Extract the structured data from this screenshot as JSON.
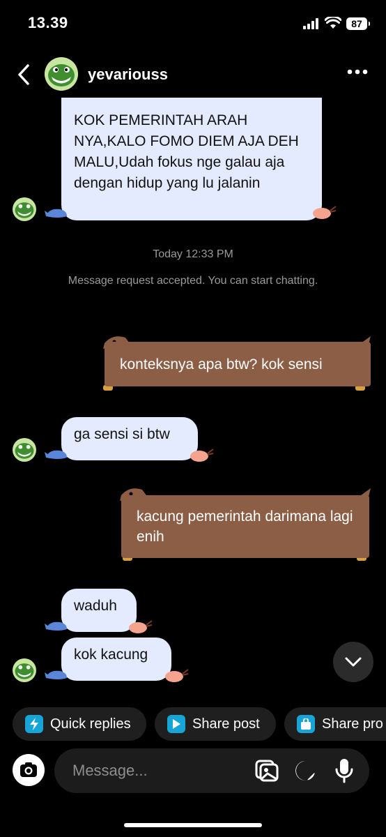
{
  "status_bar": {
    "time": "13.39",
    "battery": "87"
  },
  "header": {
    "username": "yevariouss"
  },
  "messages": {
    "first_incoming": "KOK PEMERINTAH ARAH NYA,KALO FOMO DIEM AJA DEH MALU,Udah fokus nge galau aja dengan hidup yang lu jalanin",
    "timestamp": "Today 12:33 PM",
    "system_note": "Message request accepted. You can start chatting.",
    "outgoing_1": "konteksnya apa btw? kok sensi",
    "incoming_2": "ga sensi si btw",
    "outgoing_2": "kacung pemerintah darimana lagi enih",
    "incoming_3": "waduh",
    "incoming_4": "kok kacung"
  },
  "quick_actions": {
    "quick_replies": "Quick replies",
    "share_post": "Share post",
    "share_product": "Share pro"
  },
  "composer": {
    "placeholder": "Message..."
  },
  "colors": {
    "incoming_bubble": "#e4ebff",
    "outgoing_bubble": "#8b5e45",
    "accent": "#17a5d8"
  }
}
